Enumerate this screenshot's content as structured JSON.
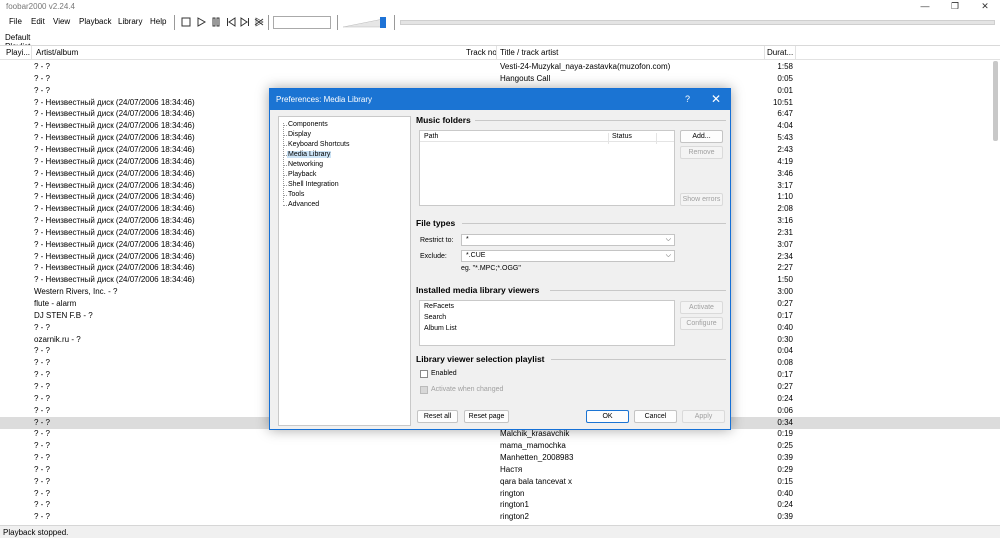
{
  "window": {
    "title": "foobar2000 v2.24.4",
    "min": "—",
    "max": "❐",
    "close": "✕"
  },
  "menu": [
    "File",
    "Edit",
    "View",
    "Playback",
    "Library",
    "Help"
  ],
  "playlist_tab": "Default Playlist",
  "columns": {
    "playing": "Playi...",
    "artist": "Artist/album",
    "track": "Track no",
    "title": "Title / track artist",
    "duration": "Durat..."
  },
  "rows": [
    {
      "artist": "? - ?",
      "title": "Vesti-24-Muzykal_naya-zastavka(muzofon.com)",
      "dur": "1:58"
    },
    {
      "artist": "? - ?",
      "title": "Hangouts Call",
      "dur": "0:05"
    },
    {
      "artist": "? - ?",
      "title": "",
      "dur": "0:01"
    },
    {
      "artist": "? - Неизвестный диск (24/07/2006 18:34:46)",
      "title": "",
      "dur": "10:51"
    },
    {
      "artist": "? - Неизвестный диск (24/07/2006 18:34:46)",
      "title": "",
      "dur": "6:47"
    },
    {
      "artist": "? - Неизвестный диск (24/07/2006 18:34:46)",
      "title": "",
      "dur": "4:04"
    },
    {
      "artist": "? - Неизвестный диск (24/07/2006 18:34:46)",
      "title": "",
      "dur": "5:43"
    },
    {
      "artist": "? - Неизвестный диск (24/07/2006 18:34:46)",
      "title": "",
      "dur": "2:43"
    },
    {
      "artist": "? - Неизвестный диск (24/07/2006 18:34:46)",
      "title": "",
      "dur": "4:19"
    },
    {
      "artist": "? - Неизвестный диск (24/07/2006 18:34:46)",
      "title": "",
      "dur": "3:46"
    },
    {
      "artist": "? - Неизвестный диск (24/07/2006 18:34:46)",
      "title": "",
      "dur": "3:17"
    },
    {
      "artist": "? - Неизвестный диск (24/07/2006 18:34:46)",
      "title": "",
      "dur": "1:10"
    },
    {
      "artist": "? - Неизвестный диск (24/07/2006 18:34:46)",
      "title": "",
      "dur": "2:08"
    },
    {
      "artist": "? - Неизвестный диск (24/07/2006 18:34:46)",
      "title": "",
      "dur": "3:16"
    },
    {
      "artist": "? - Неизвестный диск (24/07/2006 18:34:46)",
      "title": "",
      "dur": "2:31"
    },
    {
      "artist": "? - Неизвестный диск (24/07/2006 18:34:46)",
      "title": "",
      "dur": "3:07"
    },
    {
      "artist": "? - Неизвестный диск (24/07/2006 18:34:46)",
      "title": "",
      "dur": "2:34"
    },
    {
      "artist": "? - Неизвестный диск (24/07/2006 18:34:46)",
      "title": "",
      "dur": "2:27"
    },
    {
      "artist": "? - Неизвестный диск (24/07/2006 18:34:46)",
      "title": "",
      "dur": "1:50"
    },
    {
      "artist": "Western Rivers, Inc. - ?",
      "title": "",
      "dur": "3:00"
    },
    {
      "artist": "flute - alarm",
      "title": "",
      "dur": "0:27"
    },
    {
      "artist": "DJ STEN F.B - ?",
      "title": "",
      "dur": "0:17"
    },
    {
      "artist": "? - ?",
      "title": "",
      "dur": "0:40"
    },
    {
      "artist": "ozarnik.ru - ?",
      "title": "",
      "dur": "0:30"
    },
    {
      "artist": "? - ?",
      "title": "",
      "dur": "0:04"
    },
    {
      "artist": "? - ?",
      "title": "",
      "dur": "0:08"
    },
    {
      "artist": "? - ?",
      "title": "",
      "dur": "0:17"
    },
    {
      "artist": "? - ?",
      "title": "",
      "dur": "0:27"
    },
    {
      "artist": "? - ?",
      "title": "",
      "dur": "0:24"
    },
    {
      "artist": "? - ?",
      "title": "",
      "dur": "0:06"
    },
    {
      "artist": "? - ?",
      "title": "",
      "dur": "0:34",
      "selected": true
    },
    {
      "artist": "? - ?",
      "title": "Malchik_krasavchik",
      "dur": "0:19"
    },
    {
      "artist": "? - ?",
      "title": "mama_mamochka",
      "dur": "0:25"
    },
    {
      "artist": "? - ?",
      "title": "Manhetten_2008983",
      "dur": "0:39"
    },
    {
      "artist": "? - ?",
      "title": "Настя",
      "dur": "0:29"
    },
    {
      "artist": "? - ?",
      "title": "qara bala tancevat x",
      "dur": "0:15"
    },
    {
      "artist": "? - ?",
      "title": "rington",
      "dur": "0:40"
    },
    {
      "artist": "? - ?",
      "title": "rington1",
      "dur": "0:24"
    },
    {
      "artist": "? - ?",
      "title": "rington2",
      "dur": "0:39"
    }
  ],
  "status": "Playback stopped.",
  "dialog": {
    "title": "Preferences: Media Library",
    "help": "?",
    "close": "✕",
    "tree": [
      "Components",
      "Display",
      "Keyboard Shortcuts",
      "Media Library",
      "Networking",
      "Playback",
      "Shell Integration",
      "Tools",
      "Advanced"
    ],
    "music_folders": {
      "heading": "Music folders",
      "col_path": "Path",
      "col_status": "Status",
      "add": "Add...",
      "remove": "Remove",
      "show_errors": "Show errors"
    },
    "file_types": {
      "heading": "File types",
      "restrict_label": "Restrict to:",
      "restrict_value": "*",
      "exclude_label": "Exclude:",
      "exclude_value": "*.CUE",
      "hint": "eg. \"*.MPC;*.OGG\""
    },
    "viewers": {
      "heading": "Installed media library viewers",
      "items": [
        "ReFacets",
        "Search",
        "Album List"
      ],
      "activate": "Activate",
      "configure": "Configure"
    },
    "selection_playlist": {
      "heading": "Library viewer selection playlist",
      "enabled": "Enabled",
      "activate_changed": "Activate when changed"
    },
    "buttons": {
      "reset_all": "Reset all",
      "reset_page": "Reset page",
      "ok": "OK",
      "cancel": "Cancel",
      "apply": "Apply"
    }
  }
}
